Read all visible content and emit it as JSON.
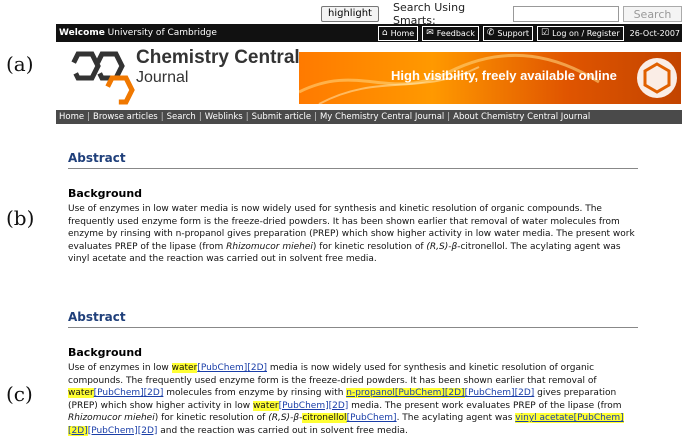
{
  "labels": {
    "a": "(a)",
    "b": "(b)",
    "c": "(c)"
  },
  "header": {
    "highlight_button": "highlight",
    "search_label": "Search Using Smarts:",
    "search_input_value": "",
    "search_button": "Search",
    "welcome_bold": "Welcome",
    "welcome_org": "University of Cambridge",
    "top_links": [
      "Home",
      "Feedback",
      "Support",
      "Log on / Register"
    ],
    "date": "26-Oct-2007",
    "journal_title": "Chemistry Central",
    "journal_sub": "Journal",
    "banner_text": "High visibility, freely available online",
    "nav": [
      "Home",
      "Browse articles",
      "Search",
      "Weblinks",
      "Submit article",
      "My Chemistry Central Journal",
      "About Chemistry Central Journal"
    ]
  },
  "abstract_b": {
    "title": "Abstract",
    "heading": "Background",
    "body": [
      {
        "t": "Use of enzymes in low water media is now widely used for synthesis and kinetic resolution of organic compounds. The frequently used enzyme form is the freeze-dried powders. It has been shown earlier that removal of water molecules from enzyme by rinsing with n-propanol gives preparation (PREP) which show higher activity in low water media. The present work evaluates PREP of the lipase (from "
      },
      {
        "t": "Rhizomucor miehei",
        "s": "i"
      },
      {
        "t": ") for kinetic resolution of "
      },
      {
        "t": "(R,S)-β",
        "s": "i"
      },
      {
        "t": "-citronellol. The acylating agent was vinyl acetate and the reaction was carried out in solvent free media."
      }
    ]
  },
  "abstract_c": {
    "title": "Abstract",
    "heading": "Background",
    "body": [
      {
        "t": "Use of enzymes in low "
      },
      {
        "t": "water",
        "s": "h"
      },
      {
        "t": "[PubChem]",
        "s": "l"
      },
      {
        "t": "[2D]",
        "s": "l"
      },
      {
        "t": " media is now widely used for synthesis and kinetic resolution of organic compounds. The frequently used enzyme form is the freeze-dried powders. It has been shown earlier that removal of "
      },
      {
        "t": "water",
        "s": "h"
      },
      {
        "t": "[PubChem]",
        "s": "l"
      },
      {
        "t": "[2D]",
        "s": "l"
      },
      {
        "t": " molecules from enzyme by rinsing with "
      },
      {
        "t": "n-propanol[PubChem][2D]",
        "s": "hl"
      },
      {
        "t": "[PubChem]",
        "s": "l"
      },
      {
        "t": "[2D]",
        "s": "l"
      },
      {
        "t": " gives preparation (PREP) which show higher activity in low "
      },
      {
        "t": "water",
        "s": "h"
      },
      {
        "t": "[PubChem]",
        "s": "l"
      },
      {
        "t": "[2D]",
        "s": "l"
      },
      {
        "t": " media. The present work evaluates PREP of the lipase (from "
      },
      {
        "t": "Rhizomucor miehei",
        "s": "i"
      },
      {
        "t": ") for kinetic resolution of "
      },
      {
        "t": "(R,S)-β",
        "s": "i"
      },
      {
        "t": "-"
      },
      {
        "t": "citronellol",
        "s": "h"
      },
      {
        "t": "[PubChem]",
        "s": "l"
      },
      {
        "t": ". The acylating agent was "
      },
      {
        "t": "vinyl acetate[PubChem][2D]",
        "s": "hl"
      },
      {
        "t": "[PubChem]",
        "s": "l"
      },
      {
        "t": "[2D]",
        "s": "l"
      },
      {
        "t": " and the reaction was carried out in solvent free media."
      }
    ]
  },
  "colors": {
    "banner": "#ff8800",
    "title": "#1f3f7a",
    "highlight": "#ffff33",
    "link": "#1a3ea8"
  }
}
